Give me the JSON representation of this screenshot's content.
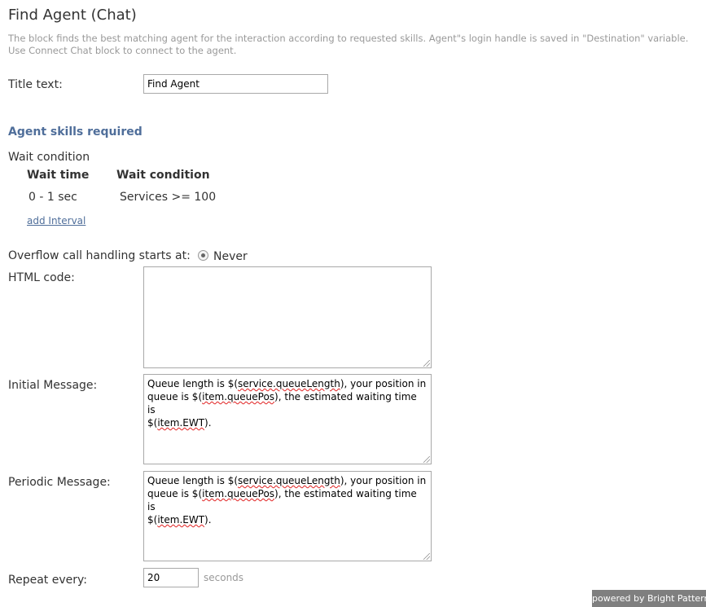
{
  "title": "Find Agent (Chat)",
  "description": {
    "line1": "The block finds the best matching agent for the interaction according to requested skills. Agent\"s login handle is saved in \"Destination\" variable.",
    "line2": "Use Connect Chat block to connect to the agent."
  },
  "title_text": {
    "label": "Title text:",
    "value": "Find Agent"
  },
  "skills": {
    "heading": "Agent skills required"
  },
  "wait": {
    "label": "Wait condition",
    "columns": [
      "Wait time",
      "Wait condition"
    ],
    "rows": [
      {
        "time": "0 - 1 sec",
        "condition": "Services >= 100"
      }
    ],
    "add_link": "add Interval"
  },
  "overflow": {
    "label": "Overflow call handling starts at:",
    "option": "Never"
  },
  "html_code": {
    "label": "HTML code:",
    "value": ""
  },
  "initial_message": {
    "label": "Initial Message:",
    "lines": [
      [
        "Queue length is $(",
        "service.queueLength",
        "), your position in"
      ],
      [
        "queue is $(",
        "item.queuePos",
        "), the estimated waiting time is"
      ],
      [
        "$(",
        "item.EWT",
        ")."
      ]
    ]
  },
  "periodic_message": {
    "label": "Periodic Message:",
    "lines": [
      [
        "Queue length is $(",
        "service.queueLength",
        "), your position in"
      ],
      [
        "queue is $(",
        "item.queuePos",
        "), the estimated waiting time is"
      ],
      [
        "$(",
        "item.EWT",
        ")."
      ]
    ]
  },
  "repeat": {
    "label": "Repeat every:",
    "value": "20",
    "unit": "seconds"
  },
  "footer": {
    "powered_by": "powered by Bright Pattern"
  }
}
